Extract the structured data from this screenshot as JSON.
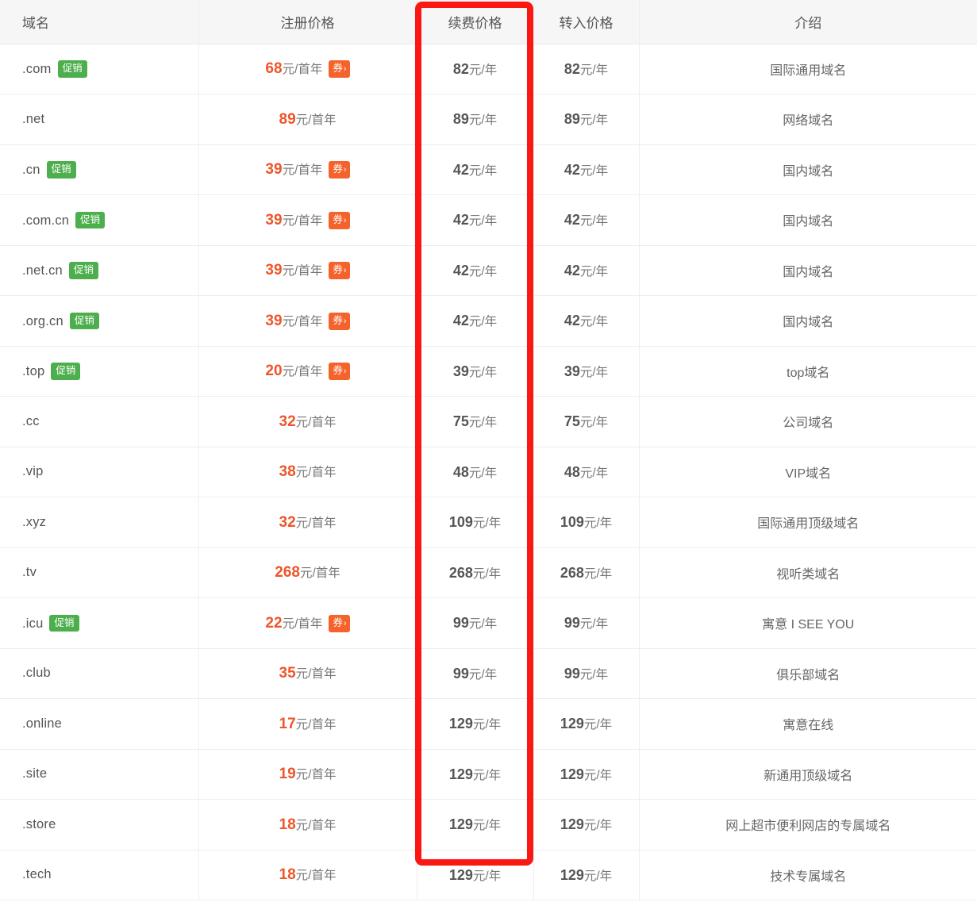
{
  "table": {
    "columns": [
      {
        "key": "domain",
        "label": "域名",
        "align": "left"
      },
      {
        "key": "reg",
        "label": "注册价格",
        "align": "center"
      },
      {
        "key": "renew",
        "label": "续费价格",
        "align": "center"
      },
      {
        "key": "transfer",
        "label": "转入价格",
        "align": "center"
      },
      {
        "key": "desc",
        "label": "介绍",
        "align": "center"
      }
    ],
    "badges": {
      "promo_label": "促销",
      "coupon_label": "券",
      "coupon_chevron": "›"
    },
    "units": {
      "first_year": "元/首年",
      "per_year": "元/年"
    },
    "rows": [
      {
        "domain": ".com",
        "promo": true,
        "reg_price": "68",
        "reg_unit": "元/首年",
        "coupon": true,
        "renew_price": "82",
        "renew_unit": "元/年",
        "transfer_price": "82",
        "transfer_unit": "元/年",
        "desc": "国际通用域名"
      },
      {
        "domain": ".net",
        "promo": false,
        "reg_price": "89",
        "reg_unit": "元/首年",
        "coupon": false,
        "renew_price": "89",
        "renew_unit": "元/年",
        "transfer_price": "89",
        "transfer_unit": "元/年",
        "desc": "网络域名"
      },
      {
        "domain": ".cn",
        "promo": true,
        "reg_price": "39",
        "reg_unit": "元/首年",
        "coupon": true,
        "renew_price": "42",
        "renew_unit": "元/年",
        "transfer_price": "42",
        "transfer_unit": "元/年",
        "desc": "国内域名"
      },
      {
        "domain": ".com.cn",
        "promo": true,
        "reg_price": "39",
        "reg_unit": "元/首年",
        "coupon": true,
        "renew_price": "42",
        "renew_unit": "元/年",
        "transfer_price": "42",
        "transfer_unit": "元/年",
        "desc": "国内域名"
      },
      {
        "domain": ".net.cn",
        "promo": true,
        "reg_price": "39",
        "reg_unit": "元/首年",
        "coupon": true,
        "renew_price": "42",
        "renew_unit": "元/年",
        "transfer_price": "42",
        "transfer_unit": "元/年",
        "desc": "国内域名"
      },
      {
        "domain": ".org.cn",
        "promo": true,
        "reg_price": "39",
        "reg_unit": "元/首年",
        "coupon": true,
        "renew_price": "42",
        "renew_unit": "元/年",
        "transfer_price": "42",
        "transfer_unit": "元/年",
        "desc": "国内域名"
      },
      {
        "domain": ".top",
        "promo": true,
        "reg_price": "20",
        "reg_unit": "元/首年",
        "coupon": true,
        "renew_price": "39",
        "renew_unit": "元/年",
        "transfer_price": "39",
        "transfer_unit": "元/年",
        "desc": "top域名"
      },
      {
        "domain": ".cc",
        "promo": false,
        "reg_price": "32",
        "reg_unit": "元/首年",
        "coupon": false,
        "renew_price": "75",
        "renew_unit": "元/年",
        "transfer_price": "75",
        "transfer_unit": "元/年",
        "desc": "公司域名"
      },
      {
        "domain": ".vip",
        "promo": false,
        "reg_price": "38",
        "reg_unit": "元/首年",
        "coupon": false,
        "renew_price": "48",
        "renew_unit": "元/年",
        "transfer_price": "48",
        "transfer_unit": "元/年",
        "desc": "VIP域名"
      },
      {
        "domain": ".xyz",
        "promo": false,
        "reg_price": "32",
        "reg_unit": "元/首年",
        "coupon": false,
        "renew_price": "109",
        "renew_unit": "元/年",
        "transfer_price": "109",
        "transfer_unit": "元/年",
        "desc": "国际通用顶级域名"
      },
      {
        "domain": ".tv",
        "promo": false,
        "reg_price": "268",
        "reg_unit": "元/首年",
        "coupon": false,
        "renew_price": "268",
        "renew_unit": "元/年",
        "transfer_price": "268",
        "transfer_unit": "元/年",
        "desc": "视听类域名"
      },
      {
        "domain": ".icu",
        "promo": true,
        "reg_price": "22",
        "reg_unit": "元/首年",
        "coupon": true,
        "renew_price": "99",
        "renew_unit": "元/年",
        "transfer_price": "99",
        "transfer_unit": "元/年",
        "desc": "寓意 I SEE YOU"
      },
      {
        "domain": ".club",
        "promo": false,
        "reg_price": "35",
        "reg_unit": "元/首年",
        "coupon": false,
        "renew_price": "99",
        "renew_unit": "元/年",
        "transfer_price": "99",
        "transfer_unit": "元/年",
        "desc": "俱乐部域名"
      },
      {
        "domain": ".online",
        "promo": false,
        "reg_price": "17",
        "reg_unit": "元/首年",
        "coupon": false,
        "renew_price": "129",
        "renew_unit": "元/年",
        "transfer_price": "129",
        "transfer_unit": "元/年",
        "desc": "寓意在线"
      },
      {
        "domain": ".site",
        "promo": false,
        "reg_price": "19",
        "reg_unit": "元/首年",
        "coupon": false,
        "renew_price": "129",
        "renew_unit": "元/年",
        "transfer_price": "129",
        "transfer_unit": "元/年",
        "desc": "新通用顶级域名"
      },
      {
        "domain": ".store",
        "promo": false,
        "reg_price": "18",
        "reg_unit": "元/首年",
        "coupon": false,
        "renew_price": "129",
        "renew_unit": "元/年",
        "transfer_price": "129",
        "transfer_unit": "元/年",
        "desc": "网上超市便利网店的专属域名"
      },
      {
        "domain": ".tech",
        "promo": false,
        "reg_price": "18",
        "reg_unit": "元/首年",
        "coupon": false,
        "renew_price": "129",
        "renew_unit": "元/年",
        "transfer_price": "129",
        "transfer_unit": "元/年",
        "desc": "技术专属域名"
      }
    ]
  },
  "annotation": {
    "highlight_color": "#fb1712",
    "highlight_target_column": "续费价格"
  },
  "colors": {
    "promo_badge": "#4cae4c",
    "coupon_badge": "#f5622c",
    "reg_price": "#ee552a",
    "year_price": "#555555",
    "header_bg": "#f6f6f6",
    "row_border": "#eeeeee"
  }
}
